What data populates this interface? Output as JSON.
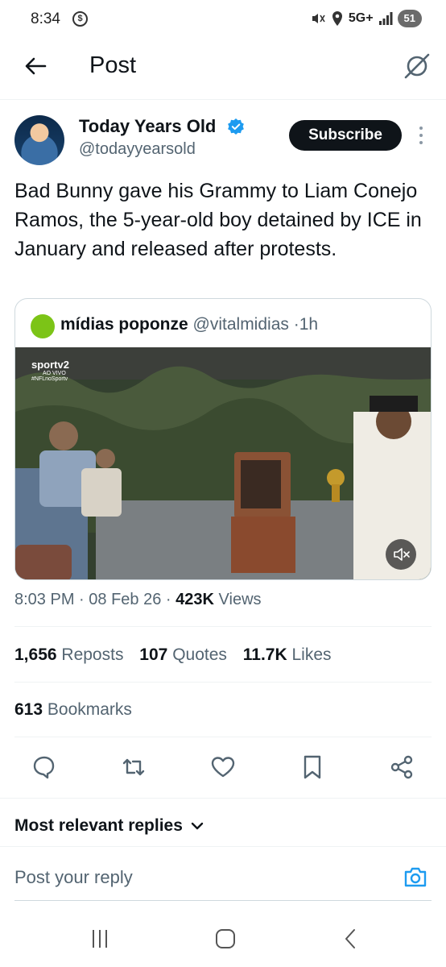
{
  "status_bar": {
    "time": "8:34",
    "left_icon": "data-saver-icon",
    "network": "5G+",
    "battery": "51",
    "icons": [
      "mute-icon",
      "location-icon",
      "signal-icon"
    ]
  },
  "header": {
    "title": "Post",
    "back_icon": "back-arrow-icon",
    "right_icon": "grok-icon"
  },
  "post": {
    "author": {
      "name": "Today Years Old",
      "handle": "@todayyearsold",
      "verified": true
    },
    "subscribe_label": "Subscribe",
    "text": "Bad Bunny gave his Grammy to Liam Conejo Ramos, the 5-year-old boy detained by ICE in January and released after protests.",
    "quote": {
      "name": "mídias poponze",
      "handle": "@vitalmidias",
      "separator": "·",
      "time": "1h",
      "media": {
        "brand": "sportv2",
        "live": "AO VIVO",
        "tag": "#NFLnoSportv"
      }
    },
    "meta": {
      "time": "8:03 PM",
      "sep1": "·",
      "date": "08 Feb 26",
      "sep2": "·",
      "views_count": "423K",
      "views_label": "Views"
    },
    "stats": {
      "reposts_count": "1,656",
      "reposts_label": "Reposts",
      "quotes_count": "107",
      "quotes_label": "Quotes",
      "likes_count": "11.7K",
      "likes_label": "Likes",
      "bookmarks_count": "613",
      "bookmarks_label": "Bookmarks"
    },
    "actions": [
      "reply-icon",
      "repost-icon",
      "like-icon",
      "bookmark-icon",
      "share-icon"
    ]
  },
  "replies": {
    "sort_label": "Most relevant replies",
    "reply_placeholder": "Post your reply"
  },
  "colors": {
    "text": "#0f1419",
    "secondary": "#536471",
    "accent": "#1d9bf0",
    "border": "#cfd9de"
  }
}
